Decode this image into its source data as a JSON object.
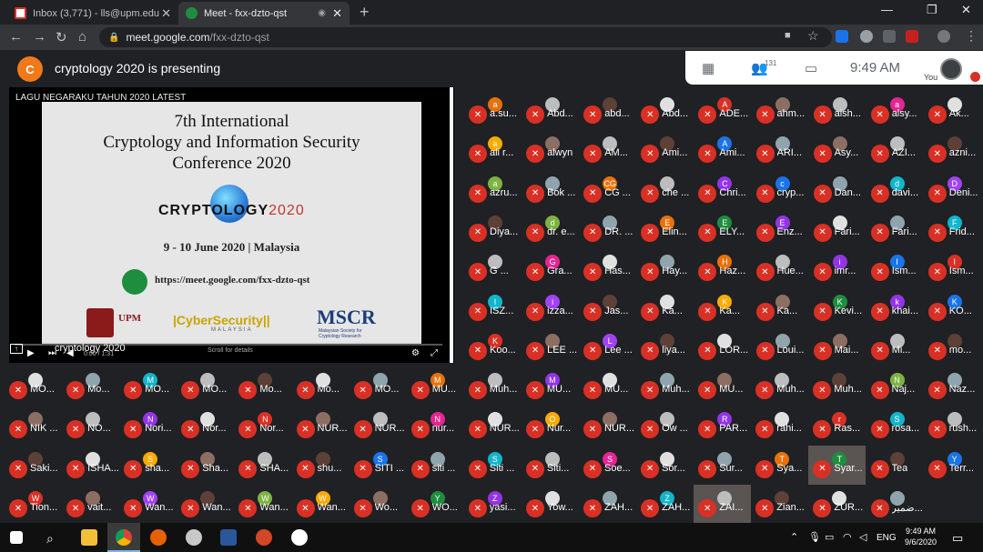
{
  "tabs": [
    {
      "title": "Inbox (3,771) - lls@upm.edu.my -"
    },
    {
      "title": "Meet - fxx-dzto-qst"
    }
  ],
  "url": {
    "host": "meet.google.com",
    "path": "/fxx-dzto-qst"
  },
  "presenter": {
    "initial": "C",
    "text": "cryptology 2020 is presenting"
  },
  "panel": {
    "participants": "131",
    "time": "9:49 AM",
    "you": "You"
  },
  "presentation": {
    "video_title": "LAGU NEGARAKU TAHUN 2020 LATEST",
    "heading1": "7th International",
    "heading2": "Cryptology and Information Security",
    "heading3": "Conference 2020",
    "brand_a": "CRYPTOLOGY",
    "brand_b": "2020",
    "dates": "9 - 10 June 2020 | Malaysia",
    "meet_url": "https://meet.google.com/fxx-dzto-qst",
    "logo_upm": "UPM",
    "logo_cs": "|CyberSecurity||",
    "logo_cs_sub": "MALAYSIA",
    "logo_mscr": "MSCR",
    "logo_mscr_sub": "Malaysian Society for Cryptology Research",
    "presenter_name": "cryptology 2020",
    "time": "0:00 / 1:31",
    "scroll_hint": "Scroll for details"
  },
  "participants": [
    [
      "a.su...",
      "Abd...",
      "abd...",
      "Abd...",
      "ADE...",
      "ahm...",
      "aish...",
      "alsy...",
      "Ak..."
    ],
    [
      "ali r...",
      "alwyn",
      "AM...",
      "Ami...",
      "Ami...",
      "ARI...",
      "Asy...",
      "AZI...",
      "azni..."
    ],
    [
      "azru...",
      "Bok ...",
      "CG ...",
      "che ...",
      "Chri...",
      "cryp...",
      "Dan...",
      "davi...",
      "Deni..."
    ],
    [
      "Diya...",
      "dr. e...",
      "DR. ...",
      "Elin...",
      "ELY...",
      "Enz...",
      "Fari...",
      "Fari...",
      "Frid..."
    ],
    [
      "G ...",
      "Gra...",
      "Has...",
      "Hay...",
      "Haz...",
      "Hue...",
      "imr...",
      "Ism...",
      "Ism..."
    ],
    [
      "ISZ...",
      "izza...",
      "Jas...",
      "Ka...",
      "Ka...",
      "Ka...",
      "Kevi...",
      "khai...",
      "KO..."
    ],
    [
      "Koo...",
      "LEE ...",
      "Lee ...",
      "liya...",
      "LOR...",
      "Loui...",
      "Mai...",
      "Mi...",
      "mo..."
    ],
    [
      "MO...",
      "Mo...",
      "MO...",
      "MO...",
      "Mo...",
      "Mo...",
      "MO...",
      "MU...",
      "Muh...",
      "MU...",
      "MU...",
      "Muh...",
      "MU...",
      "Muh...",
      "Muh...",
      "Naj...",
      "Naz..."
    ],
    [
      "NIK ...",
      "NO...",
      "Nori...",
      "Nor...",
      "Nor...",
      "NUR...",
      "NUR...",
      "nur...",
      "NUR...",
      "Nur...",
      "NUR...",
      "Ow ...",
      "PAR...",
      "rahi...",
      "Ras...",
      "rosa...",
      "rush..."
    ],
    [
      "Saki...",
      "ISHA...",
      "sha...",
      "Sha...",
      "SHA...",
      "shu...",
      "SITI ...",
      "siti ...",
      "Siti ...",
      "Siti...",
      "Soe...",
      "Sor...",
      "Sur...",
      "Sya...",
      "Syar...",
      "Tea",
      "Terr..."
    ],
    [
      "Tion...",
      "vait...",
      "Wan...",
      "Wan...",
      "Wan...",
      "Wan...",
      "Wo...",
      "WO...",
      "yasi...",
      "Yow...",
      "ZAH...",
      "ZAH...",
      "ZAI...",
      "Zian...",
      "ZUR...",
      "ضمير..."
    ]
  ],
  "avatar_letters": [
    "a",
    "",
    "",
    "",
    "A",
    "",
    "",
    "a",
    "",
    "a",
    "",
    "",
    "",
    "A",
    "",
    "",
    "",
    "",
    "a",
    "",
    "CG",
    "",
    "C",
    "c",
    "",
    "d",
    "D",
    "",
    "d",
    "",
    "E",
    "E",
    "E",
    "",
    "",
    "F",
    "",
    "G",
    "",
    "",
    "H",
    "",
    "i",
    "I",
    "I",
    "I",
    "i",
    "",
    "",
    "K",
    "",
    "K",
    "k",
    "K",
    "K",
    "",
    "L",
    "",
    "",
    "",
    "",
    "",
    "",
    "",
    "",
    "M",
    "",
    "",
    "",
    "",
    "M",
    "",
    "M",
    "",
    "",
    "",
    "",
    "",
    "N",
    "",
    "",
    "",
    "N",
    "",
    "N",
    "",
    "",
    "N",
    "",
    "O",
    "",
    "",
    "R",
    "",
    "r",
    "S",
    "",
    "",
    "",
    "S",
    "",
    "",
    "",
    "S",
    "",
    "S",
    "",
    "S",
    "",
    "",
    "T",
    "T",
    "",
    "Y",
    "W",
    "",
    "W",
    "",
    "W",
    "W",
    "",
    "Y",
    "Z",
    "",
    "",
    "Z",
    "",
    ""
  ],
  "colors": {
    "mic": "#d93025",
    "avatar_palette": [
      "#e8710a",
      "#1e8e3e",
      "#9334e6",
      "#1a73e8",
      "#d93025",
      "#12b5cb",
      "#a142f4",
      "#e52592",
      "#7cb342",
      "#f9ab00"
    ]
  },
  "taskbar": {
    "lang": "ENG",
    "time": "9:49 AM",
    "date": "9/6/2020"
  }
}
